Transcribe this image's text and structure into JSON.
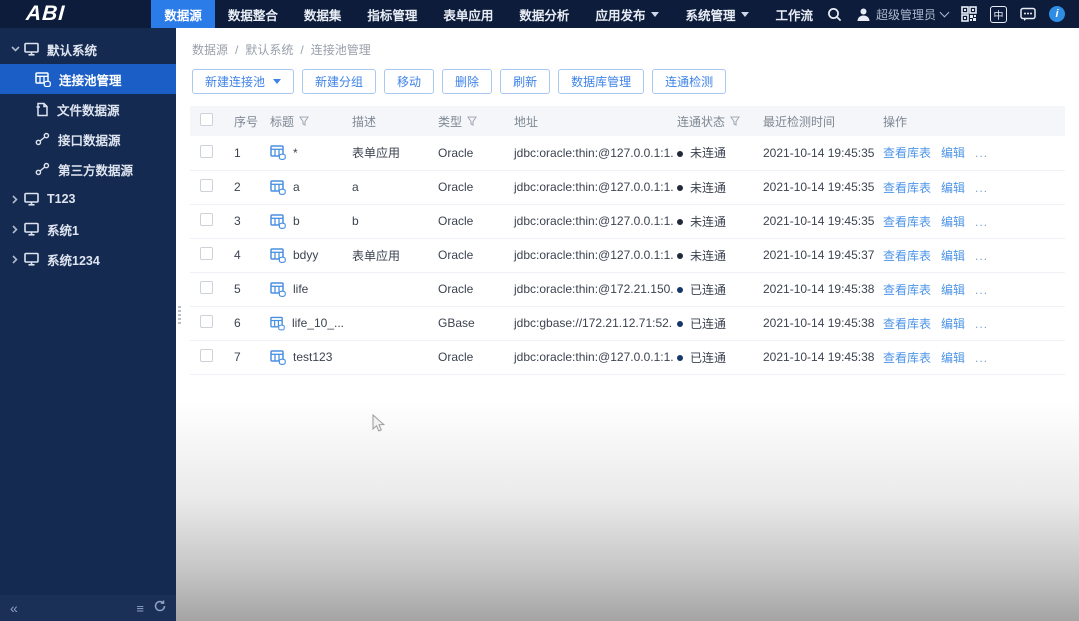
{
  "topbar": {
    "logo": "ABI",
    "menus": [
      {
        "label": "数据源",
        "active": true
      },
      {
        "label": "数据整合"
      },
      {
        "label": "数据集"
      },
      {
        "label": "指标管理"
      },
      {
        "label": "表单应用"
      },
      {
        "label": "数据分析"
      },
      {
        "label": "应用发布",
        "caret": true
      },
      {
        "label": "系统管理",
        "caret": true
      },
      {
        "label": "工作流"
      }
    ],
    "user_name": "超级管理员",
    "lang_label": "中",
    "info_label": "i",
    "icons": [
      "search-icon",
      "user-icon",
      "qrcode-icon",
      "language-icon",
      "message-icon",
      "info-icon"
    ]
  },
  "sidebar": {
    "items": [
      {
        "label": "默认系统",
        "level": 0,
        "expanded": true
      },
      {
        "label": "连接池管理",
        "level": 1,
        "selected": true
      },
      {
        "label": "文件数据源",
        "level": 1
      },
      {
        "label": "接口数据源",
        "level": 1
      },
      {
        "label": "第三方数据源",
        "level": 1
      },
      {
        "label": "T123",
        "level": 0
      },
      {
        "label": "系统1",
        "level": 0
      },
      {
        "label": "系统1234",
        "level": 0
      }
    ]
  },
  "breadcrumb": {
    "items": [
      "数据源",
      "默认系统",
      "连接池管理"
    ],
    "separator": "/"
  },
  "toolbar": {
    "new_pool": "新建连接池",
    "new_group": "新建分组",
    "move": "移动",
    "delete": "删除",
    "refresh": "刷新",
    "db_mgmt": "数据库管理",
    "conn_check": "连通检测"
  },
  "table": {
    "columns": {
      "no": "序号",
      "title": "标题",
      "desc": "描述",
      "type": "类型",
      "address": "地址",
      "status": "连通状态",
      "time": "最近检测时间",
      "ops": "操作"
    },
    "row_actions": {
      "view": "查看库表",
      "edit": "编辑",
      "more": "..."
    },
    "rows": [
      {
        "no": "1",
        "title": "*",
        "desc": "表单应用",
        "type": "Oracle",
        "address": "jdbc:oracle:thin:@127.0.0.1:1...",
        "status": "未连通",
        "time": "2021-10-14 19:45:35"
      },
      {
        "no": "2",
        "title": "a",
        "desc": "a",
        "type": "Oracle",
        "address": "jdbc:oracle:thin:@127.0.0.1:1...",
        "status": "未连通",
        "time": "2021-10-14 19:45:35"
      },
      {
        "no": "3",
        "title": "b",
        "desc": "b",
        "type": "Oracle",
        "address": "jdbc:oracle:thin:@127.0.0.1:1...",
        "status": "未连通",
        "time": "2021-10-14 19:45:35"
      },
      {
        "no": "4",
        "title": "bdyy",
        "desc": "表单应用",
        "type": "Oracle",
        "address": "jdbc:oracle:thin:@127.0.0.1:1...",
        "status": "未连通",
        "time": "2021-10-14 19:45:37"
      },
      {
        "no": "5",
        "title": "life",
        "desc": "",
        "type": "Oracle",
        "address": "jdbc:oracle:thin:@172.21.150....",
        "status": "已连通",
        "time": "2021-10-14 19:45:38"
      },
      {
        "no": "6",
        "title": "life_10_...",
        "desc": "",
        "type": "GBase",
        "address": "jdbc:gbase://172.21.12.71:52...",
        "status": "已连通",
        "time": "2021-10-14 19:45:38"
      },
      {
        "no": "7",
        "title": "test123",
        "desc": "",
        "type": "Oracle",
        "address": "jdbc:oracle:thin:@127.0.0.1:1...",
        "status": "已连通",
        "time": "2021-10-14 19:45:38"
      }
    ]
  },
  "colors": {
    "topbar_bg": "#0d1c3a",
    "sidebar_bg": "#152a50",
    "accent_blue": "#2b7ce9",
    "selected_item_bg": "#1b5fc6",
    "link_blue": "#4d94e8",
    "status_dot": {
      "未连通": "#22293a",
      "已连通": "#17386b"
    }
  }
}
